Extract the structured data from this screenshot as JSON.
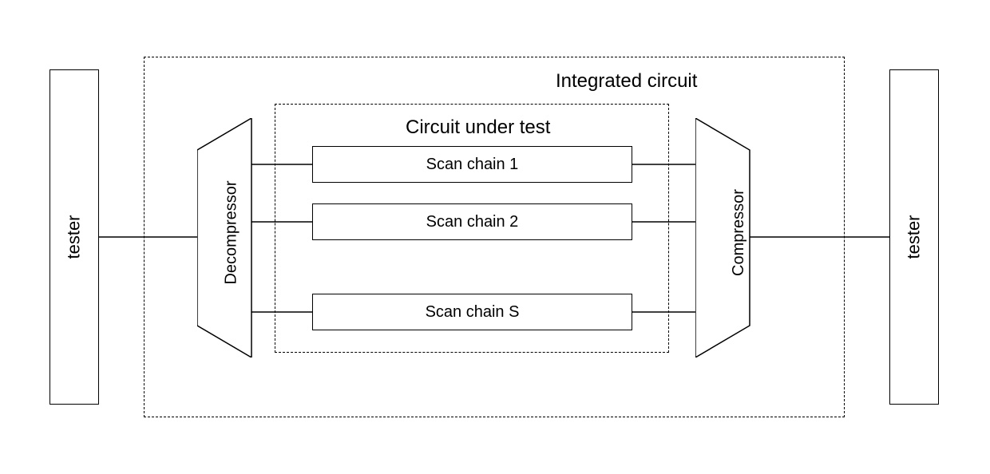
{
  "tester_left": "tester",
  "tester_right": "tester",
  "integrated_circuit_label": "Integrated circuit",
  "circuit_under_test_label": "Circuit under test",
  "decompressor_label": "Decompressor",
  "compressor_label": "Compressor",
  "scan_chains": {
    "chain1": "Scan chain 1",
    "chain2": "Scan chain 2",
    "chainS": "Scan chain S"
  }
}
